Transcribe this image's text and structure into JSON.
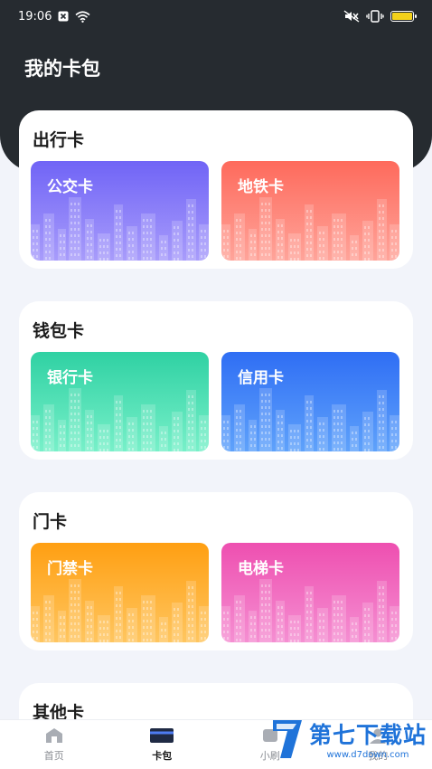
{
  "status_bar": {
    "time": "19:06",
    "icons_left": [
      "close-box-icon",
      "wifi-icon"
    ],
    "icons_right": [
      "mute-icon",
      "vibrate-icon",
      "battery-icon"
    ]
  },
  "header": {
    "title": "我的卡包"
  },
  "sections": [
    {
      "title": "出行卡",
      "cards": [
        {
          "label": "公交卡",
          "gradient": [
            "#7064f6",
            "#a89cfb"
          ]
        },
        {
          "label": "地铁卡",
          "gradient": [
            "#fe6a5c",
            "#ffa49a"
          ]
        }
      ]
    },
    {
      "title": "钱包卡",
      "cards": [
        {
          "label": "银行卡",
          "gradient": [
            "#2fd1a3",
            "#78f0c9"
          ]
        },
        {
          "label": "信用卡",
          "gradient": [
            "#2f6ef4",
            "#5fa2fb"
          ]
        }
      ]
    },
    {
      "title": "门卡",
      "cards": [
        {
          "label": "门禁卡",
          "gradient": [
            "#ff9f12",
            "#ffc660"
          ]
        },
        {
          "label": "电梯卡",
          "gradient": [
            "#ee4fb0",
            "#f58fd2"
          ]
        }
      ]
    },
    {
      "title": "其他卡",
      "cards": []
    }
  ],
  "tabbar": {
    "items": [
      {
        "label": "首页",
        "icon": "home-icon",
        "active": false
      },
      {
        "label": "卡包",
        "icon": "card-icon",
        "active": true
      },
      {
        "label": "小刷",
        "icon": "tool-icon",
        "active": false
      },
      {
        "label": "我的",
        "icon": "user-icon",
        "active": false
      }
    ]
  },
  "watermark": {
    "main": "第七下载站",
    "sub": "www.d7down.com"
  }
}
